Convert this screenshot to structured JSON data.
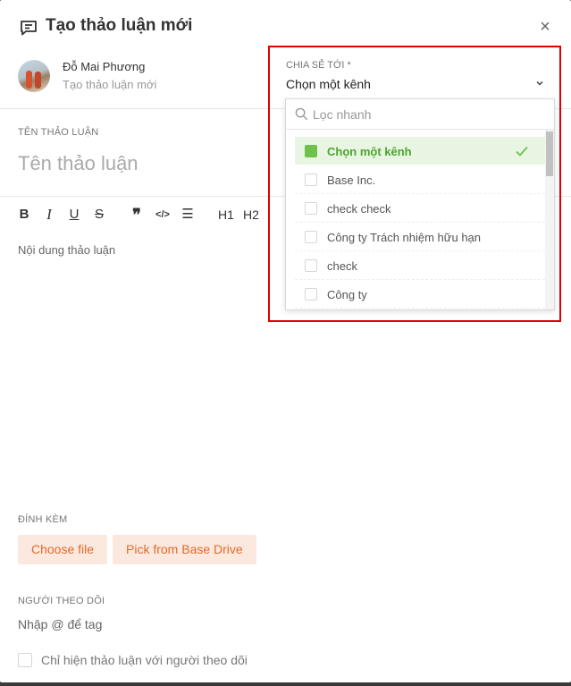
{
  "header": {
    "title": "Tạo thảo luận mới",
    "close": "×"
  },
  "author": {
    "name": "Đỗ Mai Phương",
    "subtitle": "Tạo thảo luận mới"
  },
  "title_section": {
    "label": "TÊN THẢO LUẬN",
    "placeholder": "Tên thảo luận"
  },
  "toolbar": {
    "items": [
      {
        "name": "bold",
        "glyph": "B"
      },
      {
        "name": "italic",
        "glyph": "I"
      },
      {
        "name": "underline",
        "glyph": "U"
      },
      {
        "name": "strikethrough",
        "glyph": "S"
      },
      {
        "name": "quote",
        "glyph": "❞"
      },
      {
        "name": "code",
        "glyph": "</>"
      },
      {
        "name": "align",
        "glyph": "☰"
      },
      {
        "name": "heading-1",
        "glyph": "H1"
      },
      {
        "name": "heading-2",
        "glyph": "H2"
      }
    ]
  },
  "content": {
    "placeholder": "Nội dung thảo luận"
  },
  "attachments": {
    "label": "ĐÍNH KÈM",
    "choose_file": "Choose file",
    "pick_drive": "Pick from Base Drive"
  },
  "followers": {
    "label": "NGƯỜI THEO DÕI",
    "placeholder": "Nhập @ để tag",
    "checkbox_label": "Chỉ hiện thảo luận với người theo dõi"
  },
  "share": {
    "label": "CHIA SẺ TỚI *",
    "value": "Chọn một kênh",
    "search_placeholder": "Lọc nhanh",
    "options": [
      {
        "label": "Chọn một kênh",
        "selected": true
      },
      {
        "label": "Base Inc.",
        "selected": false
      },
      {
        "label": "check check",
        "selected": false
      },
      {
        "label": "Công ty Trách nhiệm hữu hạn",
        "selected": false
      },
      {
        "label": "check",
        "selected": false
      },
      {
        "label": "Công ty",
        "selected": false
      }
    ]
  },
  "colors": {
    "accent_orange": "#e06a2d",
    "selected_green": "#6cc24a",
    "highlight_red": "#e00000"
  }
}
